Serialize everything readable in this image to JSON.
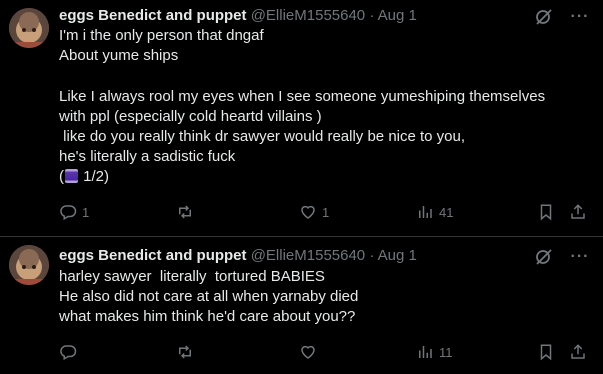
{
  "tweets": [
    {
      "author": {
        "name": "eggs Benedict and puppet",
        "handle": "@EllieM1555640",
        "separator": "·",
        "date": "Aug 1"
      },
      "text": "I'm i the only person that dngaf\nAbout yume ships\n\nLike I always rool my eyes when I see someone yumeshiping themselves\nwith ppl (especially cold heartd villains )\n like do you really think dr sawyer would really be nice to you,\nhe's literally a sadistic fuck\n(",
      "thread_counter": " 1/2)",
      "thread_emoji_icon": "thread-spool-icon",
      "stats": {
        "replies": "1",
        "retweets": "",
        "likes": "1",
        "views": "41"
      }
    },
    {
      "author": {
        "name": "eggs Benedict and puppet",
        "handle": "@EllieM1555640",
        "separator": "·",
        "date": "Aug 1"
      },
      "text": "harley sawyer  literally  tortured BABIES\nHe also did not care at all when yarnaby died\nwhat makes him think he'd care about you??",
      "stats": {
        "replies": "",
        "retweets": "",
        "likes": "",
        "views": "11"
      }
    }
  ],
  "icons": {
    "more": "···",
    "grok": "grok-icon",
    "reply": "reply-icon",
    "retweet": "retweet-icon",
    "like": "heart-icon",
    "views": "views-icon",
    "bookmark": "bookmark-icon",
    "share": "share-icon"
  },
  "colors": {
    "background": "#000000",
    "text": "#e7e9ea",
    "muted": "#71767b",
    "divider": "#2f3336"
  }
}
